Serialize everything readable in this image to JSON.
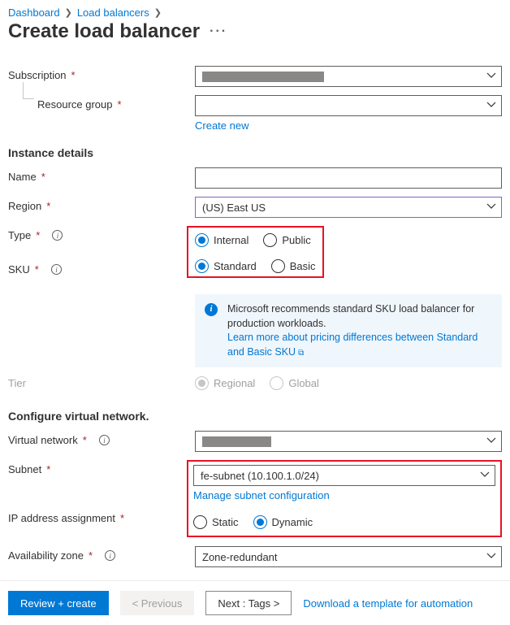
{
  "breadcrumb": {
    "l1": "Dashboard",
    "l2": "Load balancers"
  },
  "title": "Create load balancer",
  "basics": {
    "subscription_label": "Subscription",
    "resource_group_label": "Resource group",
    "create_new": "Create new"
  },
  "instance": {
    "heading": "Instance details",
    "name_label": "Name",
    "region_label": "Region",
    "region_value": "(US) East US",
    "type_label": "Type",
    "type_opts": {
      "internal": "Internal",
      "public": "Public"
    },
    "sku_label": "SKU",
    "sku_opts": {
      "standard": "Standard",
      "basic": "Basic"
    },
    "callout_text": "Microsoft recommends standard SKU load balancer for production workloads.",
    "callout_link": "Learn more about pricing differences between Standard and Basic SKU",
    "tier_label": "Tier",
    "tier_opts": {
      "regional": "Regional",
      "global": "Global"
    }
  },
  "vnet": {
    "heading": "Configure virtual network.",
    "vnet_label": "Virtual network",
    "subnet_label": "Subnet",
    "subnet_value": "fe-subnet (10.100.1.0/24)",
    "manage_link": "Manage subnet configuration",
    "ip_label": "IP address assignment",
    "ip_opts": {
      "static": "Static",
      "dynamic": "Dynamic"
    },
    "az_label": "Availability zone",
    "az_value": "Zone-redundant"
  },
  "footer": {
    "review": "Review + create",
    "prev": "<  Previous",
    "next": "Next : Tags  >",
    "download": "Download a template for automation"
  }
}
